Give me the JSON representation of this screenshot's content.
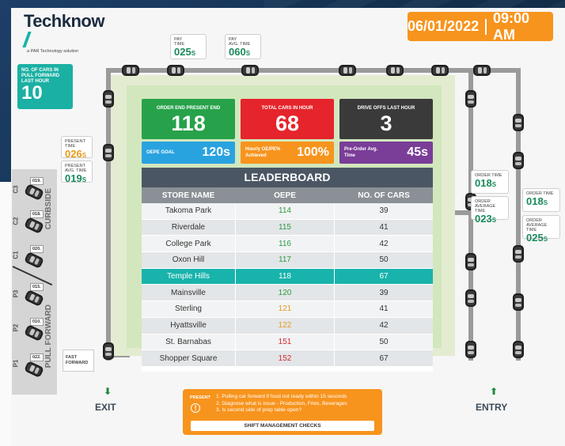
{
  "brand": {
    "name": "Techknow",
    "sub": "a PAR Technology solution"
  },
  "datetime": {
    "date": "06/01/2022",
    "time": "09:00 AM"
  },
  "pay": [
    {
      "label": "PAY",
      "sub": "TIME",
      "value": "025",
      "unit": "s"
    },
    {
      "label": "PAY",
      "sub": "AVG. TIME",
      "value": "060",
      "unit": "s"
    }
  ],
  "pull_forward": {
    "label": "NO. OF CARS IN PULL FORWARD LAST HOUR",
    "value": "10"
  },
  "present_time": {
    "label": "PRESENT TIME",
    "value": "026",
    "unit": "s"
  },
  "present_avg": {
    "label": "PRESENT AVG. TIME",
    "value": "019",
    "unit": "s"
  },
  "order_time": {
    "label": "ORDER TIME",
    "value": "018",
    "unit": "s"
  },
  "order_avg": {
    "label": "ORDER AVERAGE TIME",
    "value": "023",
    "unit": "s"
  },
  "order_time2": {
    "label": "ORDER TIME",
    "value": "018",
    "unit": "s"
  },
  "order_avg2": {
    "label": "ORDER AVERAGE TIME",
    "value": "025",
    "unit": "s"
  },
  "curbside": {
    "label": "CURBSIDE",
    "slots": [
      {
        "id": "C3",
        "tag": "019."
      },
      {
        "id": "C2",
        "tag": "018."
      },
      {
        "id": "C1",
        "tag": "020."
      }
    ]
  },
  "pullforward_lane": {
    "label": "PULL FORWARD",
    "slots": [
      {
        "id": "P3",
        "tag": "015."
      },
      {
        "id": "P2",
        "tag": "010."
      },
      {
        "id": "P1",
        "tag": "022."
      }
    ]
  },
  "fast_forward": "FAST FORWARD",
  "tiles": {
    "order_end": {
      "label": "ORDER END PRESENT END",
      "value": "118",
      "color": "#27a24a"
    },
    "total_cars": {
      "label": "TOTAL CARS IN HOUR",
      "value": "68",
      "color": "#e5242b"
    },
    "drive_offs": {
      "label": "DRIVE OFFS LAST HOUR",
      "value": "3",
      "color": "#3a3a3a"
    },
    "oepe_goal": {
      "label": "OEPE GOAL",
      "value": "120s",
      "color": "#29a3e0"
    },
    "hourly": {
      "label": "Hourly OE/PE% Achieved",
      "value": "100%",
      "color": "#f7941d"
    },
    "preorder": {
      "label": "Pre-Order Avg. Time",
      "value": "45s",
      "color": "#7a3d98"
    }
  },
  "leaderboard": {
    "title": "LEADERBOARD",
    "headers": [
      "STORE NAME",
      "OEPE",
      "NO. OF CARS"
    ],
    "rows": [
      {
        "store": "Takoma Park",
        "oepe": "114",
        "cars": "39",
        "color": "#2b9a3f"
      },
      {
        "store": "Riverdale",
        "oepe": "115",
        "cars": "41",
        "color": "#2b9a3f"
      },
      {
        "store": "College Park",
        "oepe": "116",
        "cars": "42",
        "color": "#2b9a3f"
      },
      {
        "store": "Oxon Hill",
        "oepe": "117",
        "cars": "50",
        "color": "#2b9a3f"
      },
      {
        "store": "Temple Hills",
        "oepe": "118",
        "cars": "67",
        "color": "#ffffff"
      },
      {
        "store": "Mainsville",
        "oepe": "120",
        "cars": "39",
        "color": "#2b9a3f"
      },
      {
        "store": "Sterling",
        "oepe": "121",
        "cars": "41",
        "color": "#e69b1e"
      },
      {
        "store": "Hyattsville",
        "oepe": "122",
        "cars": "42",
        "color": "#e69b1e"
      },
      {
        "store": "St. Barnabas",
        "oepe": "151",
        "cars": "50",
        "color": "#d4262c"
      },
      {
        "store": "Shopper Square",
        "oepe": "152",
        "cars": "67",
        "color": "#d4262c"
      }
    ]
  },
  "exit_label": "EXIT",
  "entry_label": "ENTRY",
  "present_panel": {
    "tag": "PRESENT",
    "lines": [
      "1. Pulling car forward if food not ready within 15 seconds",
      "2. Diagnose what is issue - Production, Fries, Beverages",
      "3. Is second side of prep table open?"
    ],
    "button": "SHIFT MANAGEMENT CHECKS"
  },
  "car_tag": "OEPE 100s"
}
